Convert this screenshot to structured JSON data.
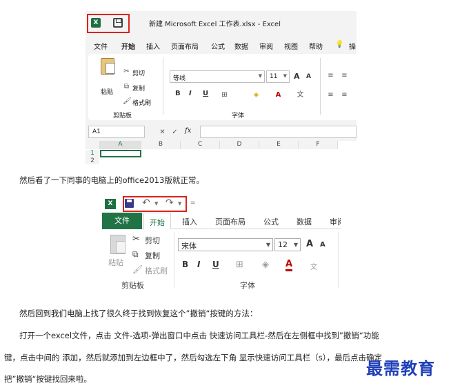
{
  "shot1": {
    "window_title": "新建 Microsoft Excel 工作表.xlsx  -  Excel",
    "logo_letter": "X",
    "menu": [
      "文件",
      "开始",
      "插入",
      "页面布局",
      "公式",
      "数据",
      "审阅",
      "视图",
      "帮助",
      "💡",
      "操"
    ],
    "clipboard": {
      "paste": "粘贴",
      "cut": "剪切",
      "copy": "复制",
      "format_painter": "格式刷",
      "group": "剪贴板"
    },
    "font": {
      "name": "等线",
      "size": "11",
      "group": "字体",
      "bold": "B",
      "italic": "I",
      "underline": "U",
      "grow": "A",
      "shrink": "A"
    },
    "name_box": "A1",
    "fx": "fx",
    "columns": [
      "A",
      "B",
      "C",
      "D",
      "E",
      "F"
    ],
    "rows": [
      "1",
      "2"
    ]
  },
  "para1": "然后看了一下同事的电脑上的office2013版就正常。",
  "shot2": {
    "logo_letter": "X",
    "undo": "↶",
    "redo": "↷",
    "customize": "=",
    "tabs": [
      "文件",
      "开始",
      "插入",
      "页面布局",
      "公式",
      "数据",
      "审阅"
    ],
    "clipboard": {
      "paste": "粘贴",
      "cut": "剪切",
      "copy": "复制",
      "format_painter": "格式刷",
      "group": "剪贴板"
    },
    "font": {
      "name": "宋体",
      "size": "12",
      "group": "字体",
      "bold": "B",
      "italic": "I",
      "underline": "U",
      "grow": "A",
      "shrink": "A"
    }
  },
  "para2": "然后回到我们电脑上找了很久终于找到恢复这个”撤销“按键的方法：",
  "para3": "打开一个excel文件，点击 文件-选项-弹出窗口中点击 快速访问工具栏-然后在左侧框中找到”撤销“功能",
  "para4": "键，点击中间的 添加，然后就添加到左边框中了，然后勾选左下角 显示快速访问工具栏（s），最后点击确定",
  "para5": "把”撤销“按键找回来啦。",
  "watermark": "最需教育",
  "colors": {
    "excel_green": "#217346",
    "highlight_red": "#d9231d",
    "watermark_blue": "#1e3fb8"
  }
}
